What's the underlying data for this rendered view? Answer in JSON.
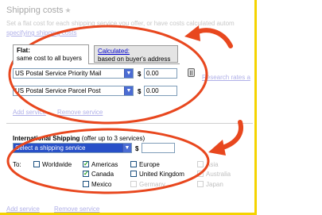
{
  "header": {
    "title": "Shipping costs",
    "star": "★",
    "description": "Set a flat cost for each shipping service you offer, or have costs calculated autom",
    "link": "specifying shipping costs"
  },
  "tabs": [
    {
      "label": "Flat:",
      "sub": "same cost to all buyers",
      "active": true
    },
    {
      "label": "Calculated:",
      "sub": "based on buyer's address",
      "active": false
    }
  ],
  "domestic": {
    "services": [
      {
        "service": "US Postal Service Priority Mail",
        "cost": "0.00"
      },
      {
        "service": "US Postal Service Parcel Post",
        "cost": "0.00"
      }
    ],
    "currency": "$",
    "research_link": "Research rates a",
    "add_service": "Add service",
    "remove_service": "Remove service"
  },
  "international": {
    "heading": "International Shipping",
    "heading_note": "(offer up to 3 services)",
    "select_placeholder": "Select a shipping service",
    "currency": "$",
    "cost": "",
    "to_label": "To:",
    "destinations": [
      {
        "label": "Worldwide",
        "checked": false,
        "faded": false
      },
      {
        "label": "Americas",
        "checked": true,
        "faded": false
      },
      {
        "label": "Europe",
        "checked": false,
        "faded": false
      },
      {
        "label": "Asia",
        "checked": false,
        "faded": true
      },
      {
        "label": "Canada",
        "checked": true,
        "faded": false
      },
      {
        "label": "United Kingdom",
        "checked": false,
        "faded": false
      },
      {
        "label": "Australia",
        "checked": false,
        "faded": true
      },
      {
        "label": "Mexico",
        "checked": false,
        "faded": false
      },
      {
        "label": "Germany",
        "checked": false,
        "faded": false
      },
      {
        "label": "Japan",
        "checked": false,
        "faded": true
      }
    ],
    "add_service": "Add service",
    "remove_service": "Remove service"
  },
  "colors": {
    "annotation": "#e8471e",
    "border": "#f5d300",
    "link": "#0000cc",
    "select_highlight": "#2850c8"
  }
}
